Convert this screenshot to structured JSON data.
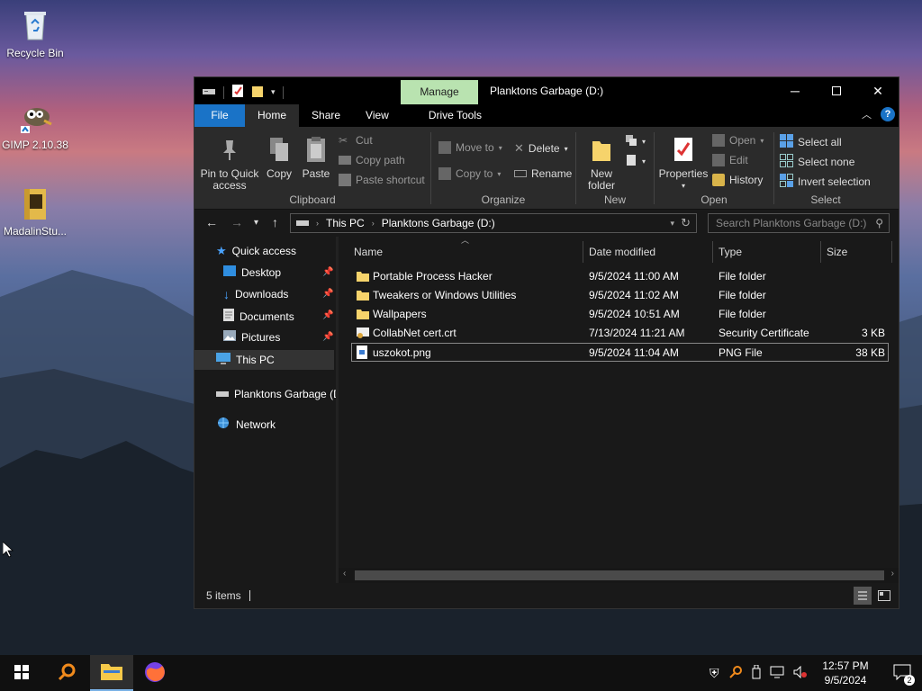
{
  "desktop": {
    "icons": [
      {
        "label": "Recycle Bin",
        "icon": "recycle-bin-icon"
      },
      {
        "label": "GIMP 2.10.38",
        "icon": "gimp-icon"
      },
      {
        "label": "MadalinStu...",
        "icon": "folder-app-icon"
      }
    ]
  },
  "window": {
    "title": "Planktons Garbage (D:)",
    "manage_tab": "Manage",
    "tabs": [
      "File",
      "Home",
      "Share",
      "View",
      "Drive Tools"
    ],
    "active_tab": "Home",
    "ribbon": {
      "clipboard": {
        "group_label": "Clipboard",
        "pin_to_quick_access": "Pin to Quick access",
        "copy": "Copy",
        "paste": "Paste",
        "cut": "Cut",
        "copy_path": "Copy path",
        "paste_shortcut": "Paste shortcut"
      },
      "organize": {
        "group_label": "Organize",
        "move_to": "Move to",
        "copy_to": "Copy to",
        "delete": "Delete",
        "rename": "Rename"
      },
      "new": {
        "group_label": "New",
        "new_folder": "New folder"
      },
      "open": {
        "group_label": "Open",
        "properties": "Properties",
        "open": "Open",
        "edit": "Edit",
        "history": "History"
      },
      "select": {
        "group_label": "Select",
        "select_all": "Select all",
        "select_none": "Select none",
        "invert_selection": "Invert selection"
      }
    },
    "address": {
      "crumbs": [
        "This PC",
        "Planktons Garbage (D:)"
      ],
      "search_placeholder": "Search Planktons Garbage (D:)"
    },
    "nav_pane": {
      "quick_access": "Quick access",
      "items": [
        {
          "label": "Desktop",
          "icon": "desktop-icon"
        },
        {
          "label": "Downloads",
          "icon": "downloads-icon"
        },
        {
          "label": "Documents",
          "icon": "documents-icon"
        },
        {
          "label": "Pictures",
          "icon": "pictures-icon"
        }
      ],
      "this_pc": "This PC",
      "drive": "Planktons Garbage (D",
      "network": "Network"
    },
    "columns": [
      "Name",
      "Date modified",
      "Type",
      "Size"
    ],
    "files": [
      {
        "name": "Portable Process Hacker",
        "date": "9/5/2024 11:00 AM",
        "type": "File folder",
        "size": "",
        "icon": "folder-icon"
      },
      {
        "name": "Tweakers or Windows Utilities",
        "date": "9/5/2024 11:02 AM",
        "type": "File folder",
        "size": "",
        "icon": "folder-icon"
      },
      {
        "name": "Wallpapers",
        "date": "9/5/2024 10:51 AM",
        "type": "File folder",
        "size": "",
        "icon": "folder-icon"
      },
      {
        "name": "CollabNet cert.crt",
        "date": "7/13/2024 11:21 AM",
        "type": "Security Certificate",
        "size": "3 KB",
        "icon": "certificate-icon"
      },
      {
        "name": "uszokot.png",
        "date": "9/5/2024 11:04 AM",
        "type": "PNG File",
        "size": "38 KB",
        "icon": "png-file-icon"
      }
    ],
    "status": {
      "item_count": "5 items"
    }
  },
  "taskbar": {
    "clock_time": "12:57 PM",
    "clock_date": "9/5/2024",
    "notification_count": "2"
  }
}
